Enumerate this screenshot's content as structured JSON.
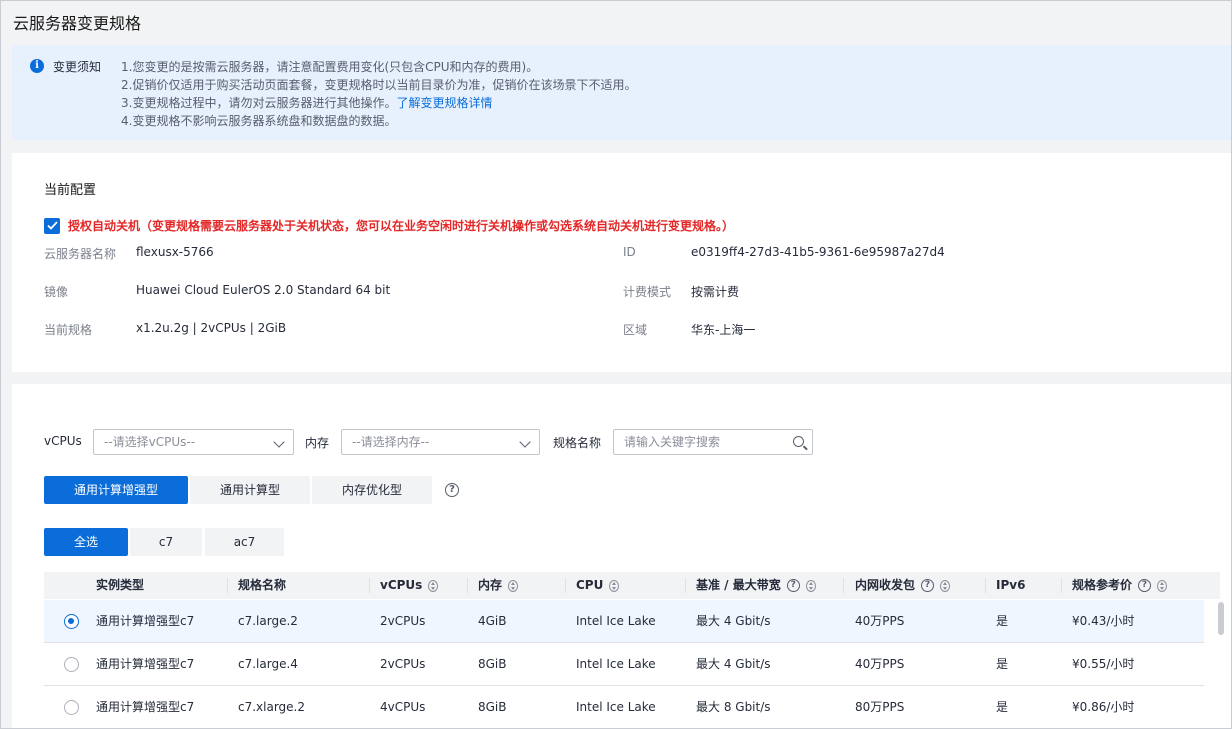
{
  "page": {
    "title": "云服务器变更规格"
  },
  "notice": {
    "title": "变更须知",
    "lines": [
      "1.您变更的是按需云服务器，请注意配置费用变化(只包含CPU和内存的费用)。",
      "2.促销价仅适用于购买活动页面套餐，变更规格时以当前目录价为准，促销价在该场景下不适用。",
      "3.变更规格过程中，请勿对云服务器进行其他操作。",
      "4.变更规格不影响云服务器系统盘和数据盘的数据。"
    ],
    "link": "了解变更规格详情"
  },
  "current": {
    "section_title": "当前配置",
    "auto_shutdown": "授权自动关机（变更规格需要云服务器处于关机状态，您可以在业务空闲时进行关机操作或勾选系统自动关机进行变更规格。）",
    "fields": {
      "name_label": "云服务器名称",
      "name_value": "flexusx-5766",
      "id_label": "ID",
      "id_value": "e0319ff4-27d3-41b5-9361-6e95987a27d4",
      "image_label": "镜像",
      "image_value": "Huawei Cloud EulerOS 2.0 Standard 64 bit",
      "billing_label": "计费模式",
      "billing_value": "按需计费",
      "spec_label": "当前规格",
      "spec_value": "x1.2u.2g | 2vCPUs | 2GiB",
      "region_label": "区域",
      "region_value": "华东-上海一"
    }
  },
  "filters": {
    "vcpus_label": "vCPUs",
    "vcpus_placeholder": "--请选择vCPUs--",
    "memory_label": "内存",
    "memory_placeholder": "--请选择内存--",
    "spec_label": "规格名称",
    "spec_placeholder": "请输入关键字搜索"
  },
  "type_tabs": [
    "通用计算增强型",
    "通用计算型",
    "内存优化型"
  ],
  "series_tabs": [
    "全选",
    "c7",
    "ac7"
  ],
  "table": {
    "headers": [
      "实例类型",
      "规格名称",
      "vCPUs",
      "内存",
      "CPU",
      "基准 / 最大带宽",
      "内网收发包",
      "IPv6",
      "规格参考价"
    ],
    "rows": [
      [
        "通用计算增强型c7",
        "c7.large.2",
        "2vCPUs",
        "4GiB",
        "Intel Ice Lake",
        "最大 4 Gbit/s",
        "40万PPS",
        "是",
        "¥0.43/小时"
      ],
      [
        "通用计算增强型c7",
        "c7.large.4",
        "2vCPUs",
        "8GiB",
        "Intel Ice Lake",
        "最大 4 Gbit/s",
        "40万PPS",
        "是",
        "¥0.55/小时"
      ],
      [
        "通用计算增强型c7",
        "c7.xlarge.2",
        "4vCPUs",
        "8GiB",
        "Intel Ice Lake",
        "最大 8 Gbit/s",
        "80万PPS",
        "是",
        "¥0.86/小时"
      ]
    ]
  },
  "colors": {
    "accent": "#0a6dd9",
    "warning": "#e42828"
  }
}
